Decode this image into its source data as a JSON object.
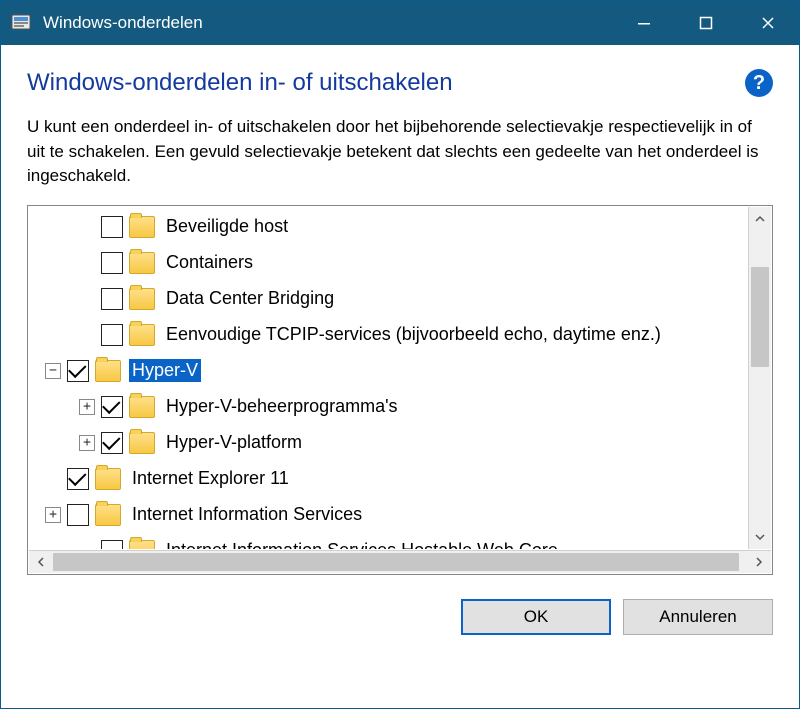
{
  "titlebar": {
    "title": "Windows-onderdelen"
  },
  "heading": "Windows-onderdelen in- of uitschakelen",
  "description": "U kunt een onderdeel in- of uitschakelen door het bijbehorende selectievakje respectievelijk in of uit te schakelen. Een gevuld selectievakje betekent dat slechts een gedeelte van het onderdeel is ingeschakeld.",
  "tree": {
    "items": [
      {
        "indent": 1,
        "expander": null,
        "checked": false,
        "label": "Beveiligde host",
        "selected": false
      },
      {
        "indent": 1,
        "expander": null,
        "checked": false,
        "label": "Containers",
        "selected": false
      },
      {
        "indent": 1,
        "expander": null,
        "checked": false,
        "label": "Data Center Bridging",
        "selected": false
      },
      {
        "indent": 1,
        "expander": null,
        "checked": false,
        "label": "Eenvoudige TCPIP-services (bijvoorbeeld echo, daytime enz.)",
        "selected": false
      },
      {
        "indent": 0,
        "expander": "minus",
        "checked": true,
        "label": "Hyper-V",
        "selected": true
      },
      {
        "indent": 1,
        "expander": "plus",
        "checked": true,
        "label": "Hyper-V-beheerprogramma's",
        "selected": false
      },
      {
        "indent": 1,
        "expander": "plus",
        "checked": true,
        "label": "Hyper-V-platform",
        "selected": false
      },
      {
        "indent": 0,
        "expander": null,
        "checked": true,
        "label": "Internet Explorer 11",
        "selected": false
      },
      {
        "indent": 0,
        "expander": "plus",
        "checked": false,
        "label": "Internet Information Services",
        "selected": false
      },
      {
        "indent": 1,
        "expander": null,
        "checked": false,
        "label": "Internet Information Services Hostable Web Core",
        "selected": false
      }
    ]
  },
  "buttons": {
    "ok": "OK",
    "cancel": "Annuleren"
  }
}
